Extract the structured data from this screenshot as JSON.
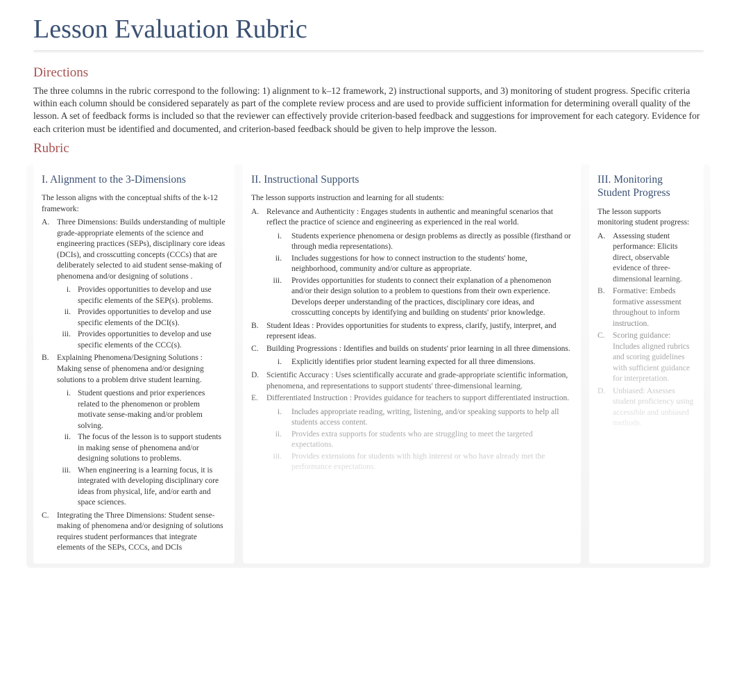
{
  "title": "Lesson Evaluation Rubric",
  "directions": {
    "heading": "Directions",
    "text": "The three columns in the rubric correspond to the following: 1) alignment to k–12 framework, 2) instructional supports, and 3) monitoring of student progress. Specific criteria within each column should be considered separately as part of the complete review process and are used to provide sufficient information for determining overall quality of the lesson. A set of feedback forms is included so that the reviewer can effectively provide criterion-based feedback and suggestions for improvement for each category. Evidence for each criterion must be identified and documented, and criterion-based feedback should be given to help improve the lesson."
  },
  "rubric_heading": "Rubric",
  "col1": {
    "title": "I.  Alignment to the 3-Dimensions",
    "intro": "The lesson aligns with the conceptual shifts of the k-12 framework:",
    "items": [
      {
        "marker": "A.",
        "text": "Three Dimensions: Builds understanding of multiple grade-appropriate elements of the science and engineering practices (SEPs), disciplinary core ideas (DCIs), and crosscutting concepts (CCCs) that are deliberately selected to aid student sense-making of phenomena and/or designing of solutions .",
        "sub": [
          {
            "marker": "i.",
            "text": "Provides opportunities to  develop and use specific elements of the SEP(s). problems."
          },
          {
            "marker": "ii.",
            "text": "Provides opportunities to  develop and use specific elements of the DCI(s)."
          },
          {
            "marker": "iii.",
            "text": "Provides opportunities to  develop and use specific elements of the CCC(s)."
          }
        ]
      },
      {
        "marker": "B.",
        "text": "Explaining Phenomena/Designing Solutions : Making sense of phenomena and/or designing solutions to a problem drive student learning.",
        "sub": [
          {
            "marker": "i.",
            "text": "Student questions and prior experiences related to the phenomenon or problem motivate sense-making and/or problem solving."
          },
          {
            "marker": "ii.",
            "text": "The focus of the lesson is to support students in making sense of phenomena and/or designing solutions to problems."
          },
          {
            "marker": "iii.",
            "text": "When engineering is a learning focus, it is integrated with developing disciplinary core ideas from physical, life, and/or earth and space sciences."
          }
        ]
      },
      {
        "marker": "C.",
        "text": "Integrating the Three Dimensions:  Student sense-making of phenomena and/or designing of solutions requires student performances that integrate elements of the SEPs, CCCs, and DCIs"
      }
    ]
  },
  "col2": {
    "title": "II. Instructional Supports",
    "intro": "The lesson supports instruction and learning for all students:",
    "items": [
      {
        "marker": "A.",
        "text": "Relevance and Authenticity  : Engages students in authentic and meaningful scenarios that reflect the practice of science and engineering as experienced in the real world.",
        "sub": [
          {
            "marker": "i.",
            "text": "Students experience phenomena or design problems as directly as possible (firsthand or through media representations)."
          },
          {
            "marker": "ii.",
            "text": "Includes suggestions for how to connect instruction to the students' home, neighborhood, community and/or culture as appropriate."
          },
          {
            "marker": "iii.",
            "text": "Provides opportunities for students to connect their explanation of a phenomenon and/or their design solution to a problem to questions from their own experience. Develops deeper understanding of the practices, disciplinary core ideas, and crosscutting concepts by identifying and building on students' prior knowledge."
          }
        ]
      },
      {
        "marker": "B.",
        "text": "Student Ideas  : Provides opportunities for students to express, clarify, justify, interpret, and represent ideas.",
        "sub": []
      },
      {
        "marker": "C.",
        "text": "Building Progressions  : Identifies and builds on students' prior learning in all three dimensions.",
        "sub": [
          {
            "marker": "i.",
            "text": "Explicitly identifies prior student learning expected for all three dimensions."
          }
        ]
      },
      {
        "marker": "D.",
        "text": "Scientific Accuracy  : Uses scientifically accurate and grade-appropriate scientific information, phenomena, and representations to support students' three-dimensional learning.",
        "sub": []
      },
      {
        "marker": "E.",
        "text": "Differentiated Instruction  : Provides guidance for teachers to support differentiated instruction.",
        "sub": [
          {
            "marker": "i.",
            "text": "Includes appropriate reading, writing, listening, and/or speaking supports to help all students access content."
          },
          {
            "marker": "ii.",
            "text": "Provides extra supports for students who are struggling to meet the targeted expectations."
          },
          {
            "marker": "iii.",
            "text": "Provides extensions for students with high interest or who have already met the performance expectations."
          }
        ]
      }
    ]
  },
  "col3": {
    "title": "III. Monitoring Student Progress",
    "intro": "The lesson supports monitoring student progress:",
    "items": [
      {
        "marker": "A.",
        "text": "Assessing student performance: Elicits direct, observable evidence of three-dimensional learning."
      },
      {
        "marker": "B.",
        "text": "Formative: Embeds formative assessment throughout to inform instruction."
      },
      {
        "marker": "C.",
        "text": "Scoring guidance: Includes aligned rubrics and scoring guidelines with sufficient guidance for interpretation."
      },
      {
        "marker": "D.",
        "text": "Unbiased: Assesses student proficiency using accessible and unbiased methods."
      }
    ]
  }
}
